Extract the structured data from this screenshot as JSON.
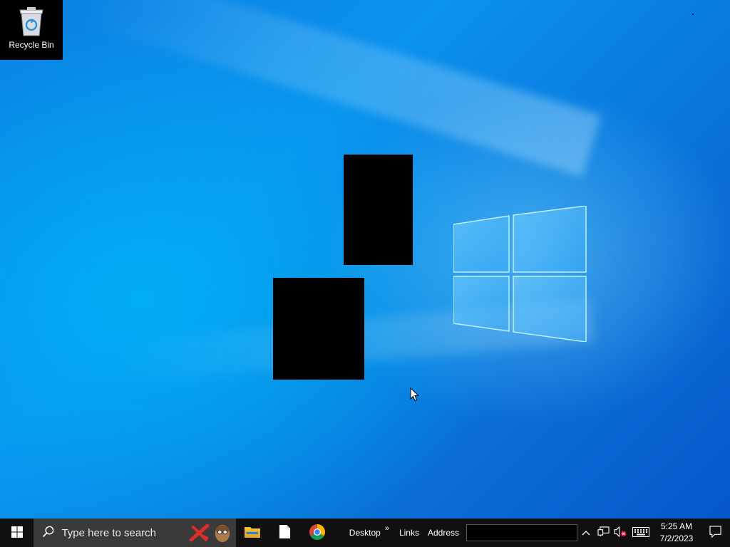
{
  "desktop": {
    "icons": [
      {
        "label": "Recycle Bin",
        "icon": "recycle-bin-icon"
      }
    ]
  },
  "taskbar": {
    "start_icon": "windows-start-icon",
    "search_placeholder": "Type here to search",
    "pinned_apps": [
      {
        "name": "File Explorer",
        "icon": "folder-icon"
      },
      {
        "name": "Notepad",
        "icon": "document-icon"
      },
      {
        "name": "Google Chrome",
        "icon": "chrome-icon"
      }
    ],
    "toolbars": {
      "desktop_label": "Desktop",
      "overflow_glyph": "»",
      "links_label": "Links",
      "address_label": "Address",
      "address_value": ""
    },
    "tray": {
      "clock_time": "5:25 AM",
      "clock_date": "7/2/2023"
    }
  },
  "colors": {
    "accent": "#0a7fe0",
    "taskbar_bg": "#101010"
  }
}
